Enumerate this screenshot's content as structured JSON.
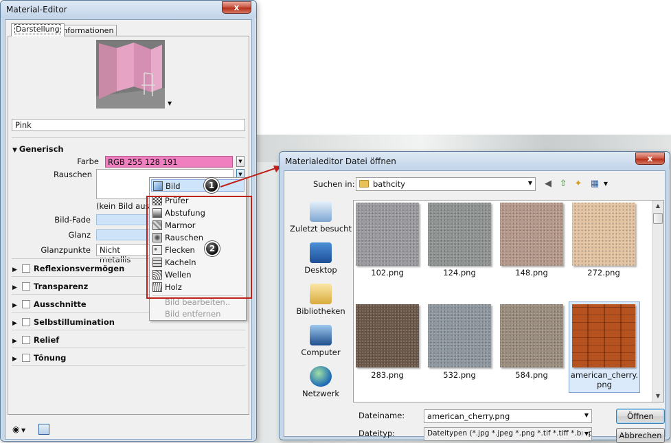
{
  "material_editor": {
    "title": "Material-Editor",
    "close": "x",
    "tabs": [
      "Darstellung",
      "Informationen"
    ],
    "material_name": "Pink",
    "section_generic": "Generisch",
    "farbe_label": "Farbe",
    "farbe_value": "RGB 255 128 191",
    "farbe_color": "#f07fc0",
    "rauschen_label": "Rauschen",
    "no_image_text": "(kein Bild ausg",
    "bild_fade_label": "Bild-Fade",
    "glanz_label": "Glanz",
    "glanzpunkte_label": "Glanzpunkte",
    "glanzpunkte_value": "Nicht metallis",
    "sections": [
      "Reflexionsvermögen",
      "Transparenz",
      "Ausschnitte",
      "Selbstillumination",
      "Relief",
      "Tönung"
    ]
  },
  "dropdown_menu": {
    "items": [
      "Bild",
      "Prüfer",
      "Abstufung",
      "Marmor",
      "Rauschen",
      "Flecken",
      "Kacheln",
      "Wellen",
      "Holz"
    ],
    "disabled_items": [
      "Bild bearbeiten..",
      "Bild entfernen"
    ],
    "badges": [
      "1",
      "2"
    ]
  },
  "file_dialog": {
    "title": "Materialeditor Datei öffnen",
    "close": "x",
    "look_in_label": "Suchen in:",
    "look_in_value": "bathcity",
    "places": [
      "Zuletzt besucht",
      "Desktop",
      "Bibliotheken",
      "Computer",
      "Netzwerk"
    ],
    "files": [
      {
        "name": "102.png",
        "color": "#9a9a9e"
      },
      {
        "name": "124.png",
        "color": "#8e9291"
      },
      {
        "name": "148.png",
        "color": "#b5988a"
      },
      {
        "name": "272.png",
        "color": "#e3c3a0"
      },
      {
        "name": "283.png",
        "color": "#6a5646"
      },
      {
        "name": "532.png",
        "color": "#8d959d"
      },
      {
        "name": "584.png",
        "color": "#9a8c7c"
      },
      {
        "name": "american_cherry.png",
        "color": "#b5521f"
      }
    ],
    "file_name_label": "Dateiname:",
    "file_name_value": "american_cherry.png",
    "file_type_label": "Dateityp:",
    "file_type_value": "Dateitypen (*.jpg *.jpeg *.png *.tif *.tiff *.bmp *.ex",
    "open_button": "Öffnen",
    "cancel_button": "Abbrechen"
  }
}
